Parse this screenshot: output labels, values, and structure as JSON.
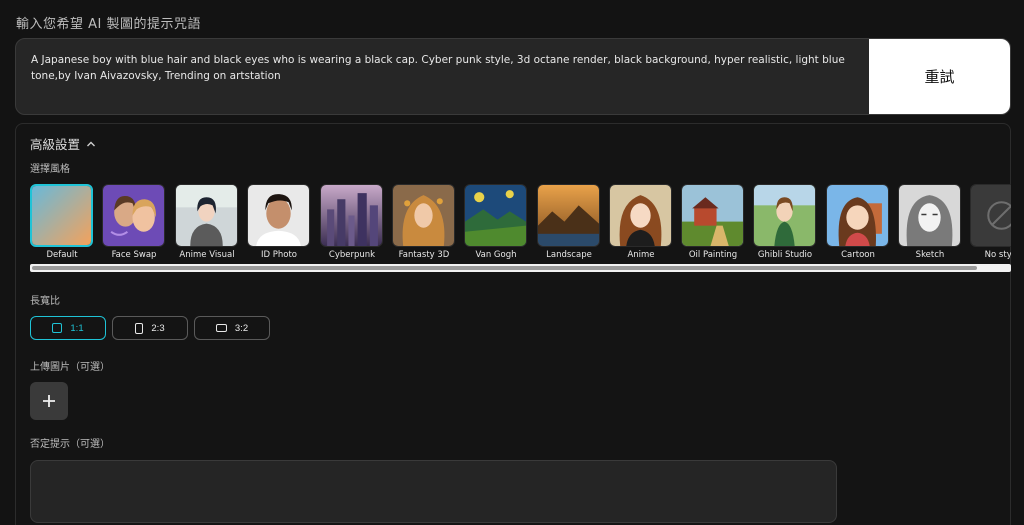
{
  "prompt": {
    "title": "輸入您希望 AI 製圖的提示咒語",
    "text": "A Japanese boy with blue hair and black eyes who is wearing a black cap. Cyber punk style, 3d octane render, black background, hyper realistic, light blue tone,by Ivan Aivazovsky, Trending on artstation",
    "retry_label": "重試"
  },
  "advanced": {
    "header": "高級設置",
    "style_label": "選擇風格",
    "styles": [
      {
        "label": "Default",
        "icon": "gradient-thumbnail",
        "selected": true
      },
      {
        "label": "Face Swap",
        "icon": "face-swap-thumbnail"
      },
      {
        "label": "Anime Visual",
        "icon": "anime-visual-thumbnail"
      },
      {
        "label": "ID Photo",
        "icon": "id-photo-thumbnail"
      },
      {
        "label": "Cyberpunk",
        "icon": "cyberpunk-thumbnail"
      },
      {
        "label": "Fantasty 3D",
        "icon": "fantasy-3d-thumbnail"
      },
      {
        "label": "Van Gogh",
        "icon": "van-gogh-thumbnail"
      },
      {
        "label": "Landscape",
        "icon": "landscape-thumbnail"
      },
      {
        "label": "Anime",
        "icon": "anime-thumbnail"
      },
      {
        "label": "Oil Painting",
        "icon": "oil-painting-thumbnail"
      },
      {
        "label": "Ghibli Studio",
        "icon": "ghibli-thumbnail"
      },
      {
        "label": "Cartoon",
        "icon": "cartoon-thumbnail"
      },
      {
        "label": "Sketch",
        "icon": "sketch-thumbnail"
      },
      {
        "label": "No style",
        "icon": "no-style-thumbnail"
      }
    ],
    "ratio_label": "長寬比",
    "ratios": [
      {
        "label": "1:1",
        "active": true
      },
      {
        "label": "2:3"
      },
      {
        "label": "3:2"
      }
    ],
    "upload_label": "上傳圖片（可選）",
    "negative_label": "否定提示（可選）",
    "negative_value": ""
  },
  "colors": {
    "accent": "#1fc3d6",
    "background": "#131313"
  }
}
